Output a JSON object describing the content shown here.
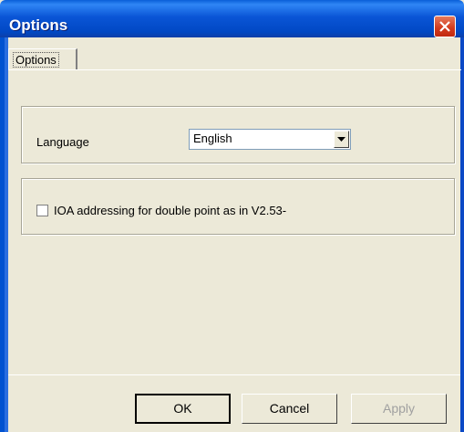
{
  "window": {
    "title": "Options"
  },
  "tabs": [
    {
      "label": "Options"
    }
  ],
  "language": {
    "label": "Language",
    "selected": "English"
  },
  "option": {
    "label": "IOA addressing for double point as in V2.53-",
    "checked": false
  },
  "buttons": {
    "ok": "OK",
    "cancel": "Cancel",
    "apply": "Apply"
  }
}
